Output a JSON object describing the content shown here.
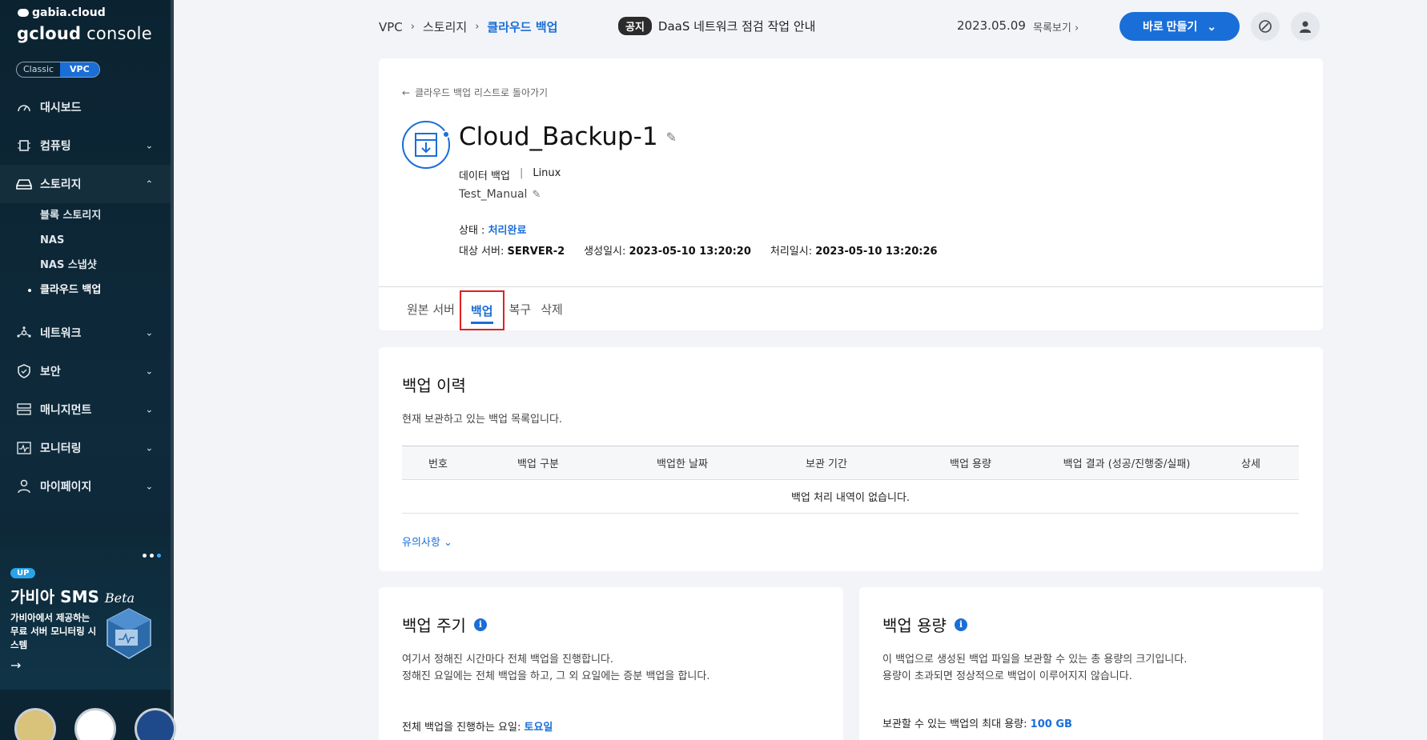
{
  "sidebar": {
    "brand_small": "gabia.cloud",
    "brand_big_bold": "gcloud",
    "brand_big_light": " console",
    "mode_classic": "Classic",
    "mode_vpc": "VPC",
    "items": [
      {
        "label": "대시보드",
        "icon": "dashboard-icon"
      },
      {
        "label": "컴퓨팅",
        "icon": "cpu-icon"
      },
      {
        "label": "스토리지",
        "icon": "storage-icon"
      },
      {
        "label": "네트워크",
        "icon": "network-icon"
      },
      {
        "label": "보안",
        "icon": "shield-icon"
      },
      {
        "label": "매니지먼트",
        "icon": "management-icon"
      },
      {
        "label": "모니터링",
        "icon": "monitor-icon"
      },
      {
        "label": "마이페이지",
        "icon": "user-icon"
      }
    ],
    "storage_sub": [
      "블록 스토리지",
      "NAS",
      "NAS 스냅샷",
      "클라우드 백업"
    ],
    "promo": {
      "badge": "UP",
      "title": "가비아 SMS",
      "title_suffix": "Beta",
      "desc": "가비아에서 제공하는 무료 서버 모니터링 시스템"
    }
  },
  "header": {
    "breadcrumb": [
      "VPC",
      "스토리지",
      "클라우드 백업"
    ],
    "notice_tag": "공지",
    "notice_text": "DaaS 네트워크 점검 작업 안내",
    "notice_date": "2023.05.09",
    "list_view": "목록보기",
    "create_label": "바로 만들기"
  },
  "detail": {
    "back_label": "클라우드 백업 리스트로 돌아가기",
    "title": "Cloud_Backup-1",
    "type": "데이터 백업",
    "os": "Linux",
    "memo": "Test_Manual",
    "status_label": "상태 : ",
    "status_value": "처리완료",
    "target_label": "대상 서버: ",
    "target_value": "SERVER-2",
    "created_label": "생성일시: ",
    "created_value": "2023-05-10 13:20:20",
    "processed_label": "처리일시: ",
    "processed_value": "2023-05-10 13:20:26",
    "tabs": [
      "원본 서버",
      "백업",
      "복구",
      "삭제"
    ],
    "active_tab": "백업"
  },
  "history": {
    "title": "백업 이력",
    "desc": "현재 보관하고 있는 백업 목록입니다.",
    "columns": [
      "번호",
      "백업 구분",
      "백업한 날짜",
      "보관 기간",
      "백업 용량",
      "백업 결과 (성공/진행중/실패)",
      "상세"
    ],
    "empty": "백업 처리 내역이 없습니다.",
    "caution": "유의사항"
  },
  "cycle": {
    "title": "백업 주기",
    "desc1": "여기서 정해진 시간마다 전체 백업을 진행합니다.",
    "desc2": "정해진 요일에는 전체 백업을 하고, 그 외 요일에는 증분 백업을 합니다.",
    "day_label": "전체 백업을 진행하는 요일: ",
    "day_value": "토요일"
  },
  "capacity": {
    "title": "백업 용량",
    "desc1": "이 백업으로 생성된 백업 파일을 보관할 수 있는 총 용량의 크기입니다.",
    "desc2": "용량이 초과되면 정상적으로 백업이 이루어지지 않습니다.",
    "max_label": "보관할 수 있는 백업의 최대 용량: ",
    "max_value": "100 GB"
  },
  "colors": {
    "accent": "#1a6ed8",
    "sidebar": "#0e2a3b",
    "highlight": "#e02020"
  }
}
